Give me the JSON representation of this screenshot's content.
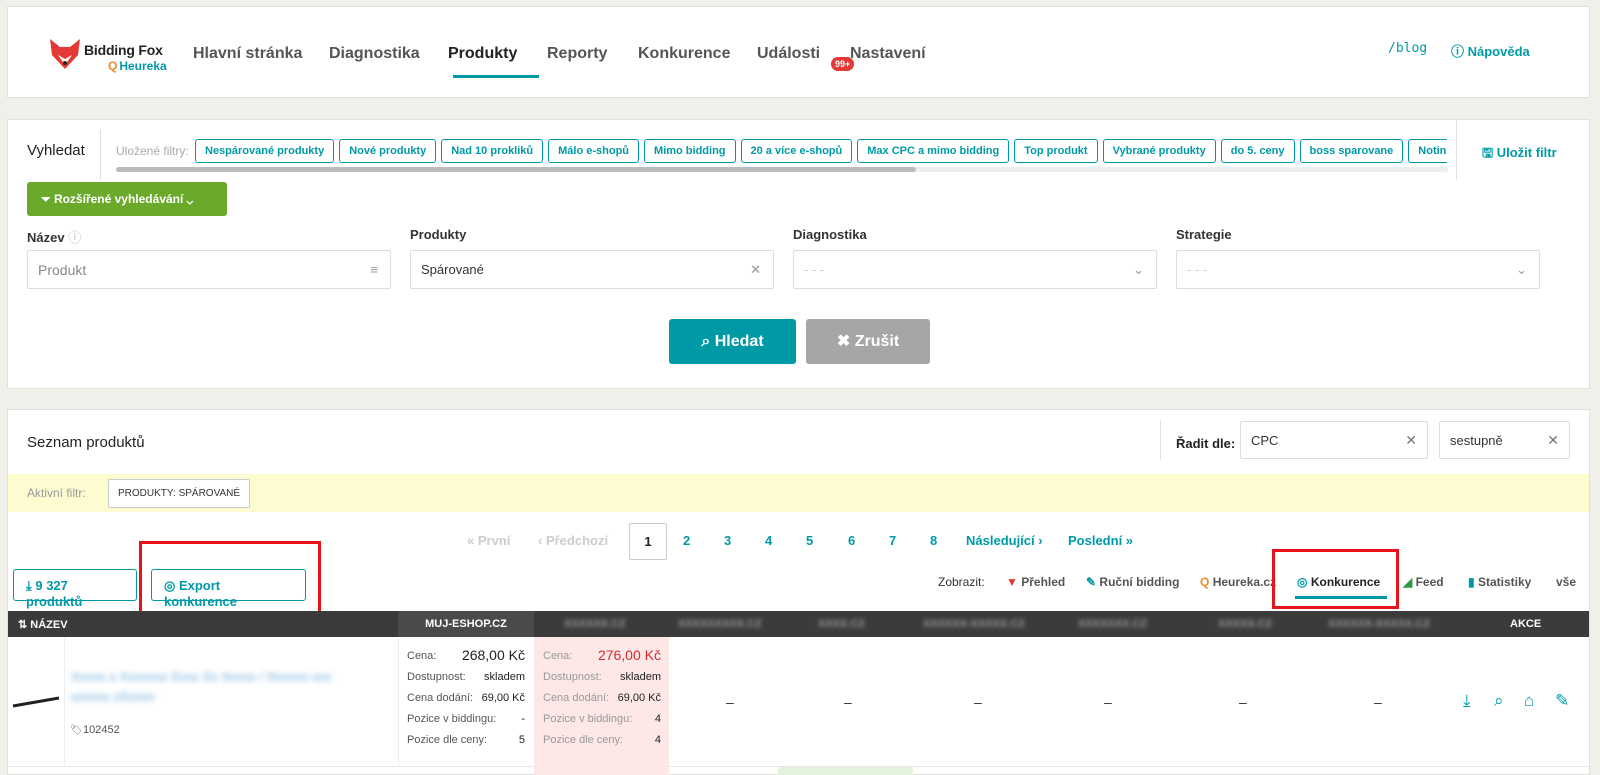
{
  "brand": {
    "name": "Bidding Fox",
    "sub": "Heureka",
    "sub_glyph": "Q"
  },
  "nav": {
    "items": [
      "Hlavní stránka",
      "Diagnostika",
      "Produkty",
      "Reporty",
      "Konkurence",
      "Události",
      "Nastavení"
    ],
    "badge": "99+",
    "blog": "/blog",
    "help": "Nápověda"
  },
  "search": {
    "title": "Vyhledat",
    "saved_label": "Uložené filtry:",
    "chips": [
      "Nespárované produkty",
      "Nové produkty",
      "Nad 10 prokliků",
      "Málo e-shopů",
      "Mimo bidding",
      "20 a více e-shopů",
      "Max CPC a mimo bidding",
      "Top produkt",
      "Vybrané produkty",
      "do 5. ceny",
      "boss sparovane",
      "Notino - "
    ],
    "save_filter": "Uložit filtr",
    "advanced": "Rozšířené vyhledávání",
    "fields": {
      "name_label": "Název",
      "name_placeholder": "Produkt",
      "products_label": "Produkty",
      "products_value": "Spárované",
      "diag_label": "Diagnostika",
      "diag_value": "- - -",
      "strategy_label": "Strategie",
      "strategy_value": "- - -"
    },
    "btn_search": "Hledat",
    "btn_cancel": "Zrušit"
  },
  "list": {
    "title": "Seznam produktů",
    "sort_label": "Řadit dle:",
    "sort_by": "CPC",
    "sort_dir": "sestupně",
    "active_filter_label": "Aktivní filtr:",
    "active_filter_tag": "PRODUKTY: SPÁROVANÉ",
    "pager": {
      "first": "« První",
      "prev": "‹ Předchozí",
      "current": "1",
      "pages": [
        "2",
        "3",
        "4",
        "5",
        "6",
        "7",
        "8"
      ],
      "next": "Následující ›",
      "last": "Poslední »"
    },
    "btn_products": "9 327 produktů",
    "btn_export": "Export konkurence",
    "view_label": "Zobrazit:",
    "views": [
      "Přehled",
      "Ruční bidding",
      "Heureka.cz",
      "Konkurence",
      "Feed",
      "Statistiky",
      "vše"
    ],
    "table": {
      "col_name": "NÁZEV",
      "col_muj": "MUJ-ESHOP.CZ",
      "col_blurred": [
        "XXXXXX.CZ",
        "XXXXXXXXX.CZ",
        "XXXX.CZ",
        "XXXXXX-XXXXX.CZ",
        "XXXXXXX.CZ",
        "XXXXX.CZ",
        "XXXXXX-XXXXX.CZ"
      ],
      "col_actions": "AKCE",
      "rows": [
        {
          "name": "Xxxxx x Xxxxxxx Xxxx Xx Xxxxx / Xxxxxx xxx xxxxxx xXxxxx",
          "id": "102452",
          "muj": {
            "price": "268,00 Kč",
            "availability": "skladem",
            "delivery": "69,00 Kč",
            "bid_pos": "-",
            "price_pos": "5"
          },
          "comp": {
            "price": "276,00 Kč",
            "availability": "skladem",
            "delivery": "69,00 Kč",
            "bid_pos": "4",
            "price_pos": "4"
          },
          "others": [
            "–",
            "–",
            "–",
            "–",
            "–",
            "–"
          ]
        }
      ],
      "labels": {
        "price": "Cena:",
        "availability": "Dostupnost:",
        "delivery": "Cena dodání:",
        "bid_pos": "Pozice v biddingu:",
        "price_pos": "Pozice dle ceny:"
      }
    }
  },
  "colors": {
    "accent": "#009aa6",
    "green": "#6aa92a",
    "red_highlight": "#e8141c"
  }
}
